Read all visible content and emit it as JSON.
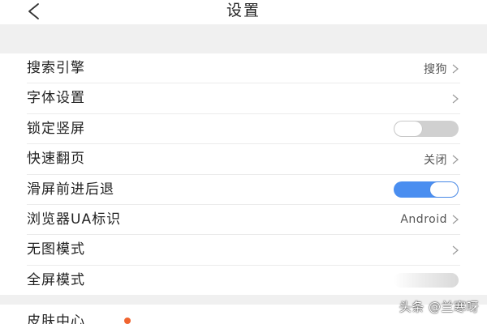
{
  "header": {
    "title": "设置",
    "back_icon": "back-arrow-icon"
  },
  "settings": {
    "search_engine": {
      "label": "搜索引擎",
      "value": "搜狗"
    },
    "font_settings": {
      "label": "字体设置"
    },
    "lock_portrait": {
      "label": "锁定竖屏",
      "toggle": "off"
    },
    "fast_page_turn": {
      "label": "快速翻页",
      "value": "关闭"
    },
    "swipe_navigation": {
      "label": "滑屏前进后退",
      "toggle": "on"
    },
    "browser_ua": {
      "label": "浏览器UA标识",
      "value": "Android"
    },
    "no_image_mode": {
      "label": "无图模式"
    },
    "fullscreen_mode": {
      "label": "全屏模式"
    }
  },
  "skin_center": {
    "label": "皮肤中心",
    "badge_color": "#f0642f"
  },
  "watermark": {
    "text": "头条 @兰寒呀"
  },
  "colors": {
    "accent": "#4a8ef0",
    "toggle_off": "#d0d0d0",
    "section_gap": "#f0f0f0",
    "badge": "#f0642f"
  }
}
